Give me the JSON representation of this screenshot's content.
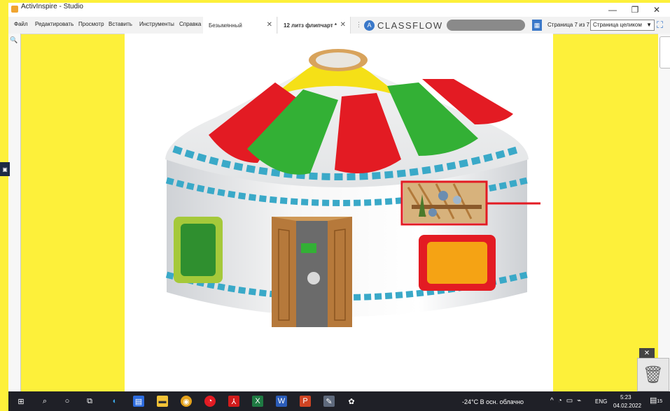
{
  "window": {
    "title": "ActivInspire - Studio",
    "controls": {
      "minimize": "—",
      "restore": "❐",
      "close": "✕"
    }
  },
  "menu": [
    "Файл",
    "Редактировать",
    "Просмотр",
    "Вставить",
    "Инструменты",
    "Справка"
  ],
  "tabs": [
    {
      "label": "Безымянный",
      "active": false
    },
    {
      "label": "12 литз флипчарт *",
      "active": true
    }
  ],
  "classflow": {
    "logo_glyph": "A",
    "label": "CLASSFLOW"
  },
  "pager": {
    "label": "Страница 7 из 7",
    "zoom": "Страница целиком"
  },
  "taskbar": {
    "weather": "-24°C  В осн. облачно",
    "lang": "ENG",
    "time": "5:23",
    "date": "04.02.2022",
    "notification_count": "15"
  },
  "colors": {
    "background": "#fdf03a",
    "taskbar": "#1f2027",
    "highlight": "#e31b23",
    "accent": "#3a78c9"
  },
  "icons": [
    "windows-start-icon",
    "search-icon",
    "cortana-icon",
    "task-view-icon",
    "edge-icon",
    "store-icon",
    "file-explorer-icon",
    "chrome-icon",
    "app-icon",
    "acrobat-icon",
    "excel-icon",
    "word-icon",
    "powerpoint-icon",
    "activinspire-icon",
    "media-icon",
    "trash-icon"
  ]
}
